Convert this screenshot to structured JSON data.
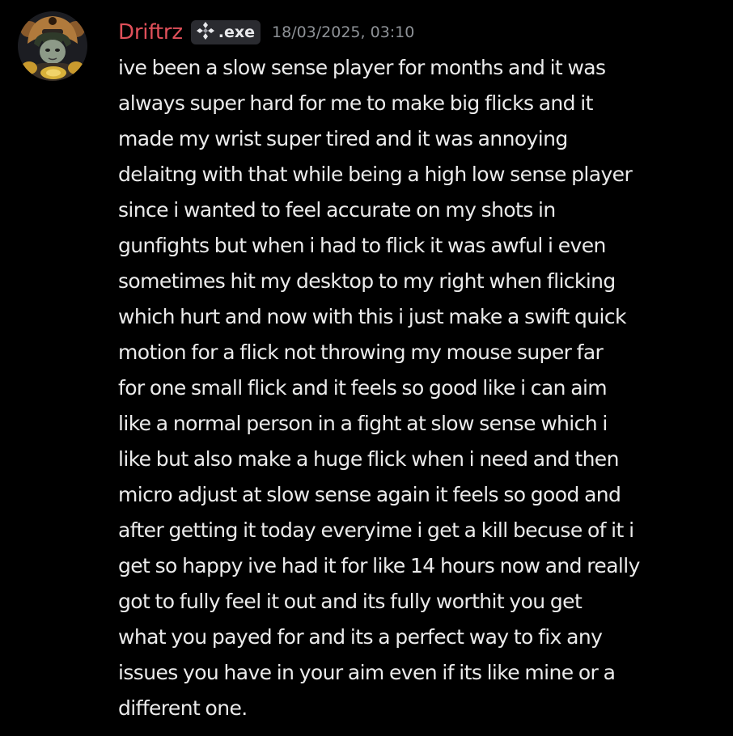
{
  "message": {
    "author": {
      "name": "Driftrz",
      "name_color": "#e0505a",
      "avatar": "character-avatar",
      "tag": {
        "icon": "diamond-tag-icon",
        "label": ".exe"
      }
    },
    "timestamp": "18/03/2025, 03:10",
    "lines": [
      "ive been a slow sense player for months and it was",
      "always super hard for me to make big flicks and it",
      "made my wrist super tired and it was annoying",
      "delaitng with that while being a high low sense player",
      "since i wanted to feel accurate on my shots in",
      "gunfights but when i had to flick it was awful i even",
      "sometimes hit my desktop to my right when flicking",
      "which hurt and now with this i just make a swift quick",
      "motion for a flick not throwing my mouse super far",
      "for one small flick and it feels so good like i can aim",
      "like a normal person in a fight at slow sense which i",
      "like but also make a huge flick when i need and then",
      "micro adjust at slow sense again it feels so good and",
      "after getting it today everyime i get a kill becuse of it i",
      "get so happy ive had it for like 14 hours now and really",
      "got to fully feel it out and its fully worthit you get",
      "what you payed for and its a perfect way to fix any",
      "issues you have in your aim even if its like mine or a",
      "different one."
    ]
  },
  "colors": {
    "background": "#000000",
    "text": "#ebebeb",
    "timestamp": "#8e9297",
    "tag_background": "#2a2b30"
  }
}
